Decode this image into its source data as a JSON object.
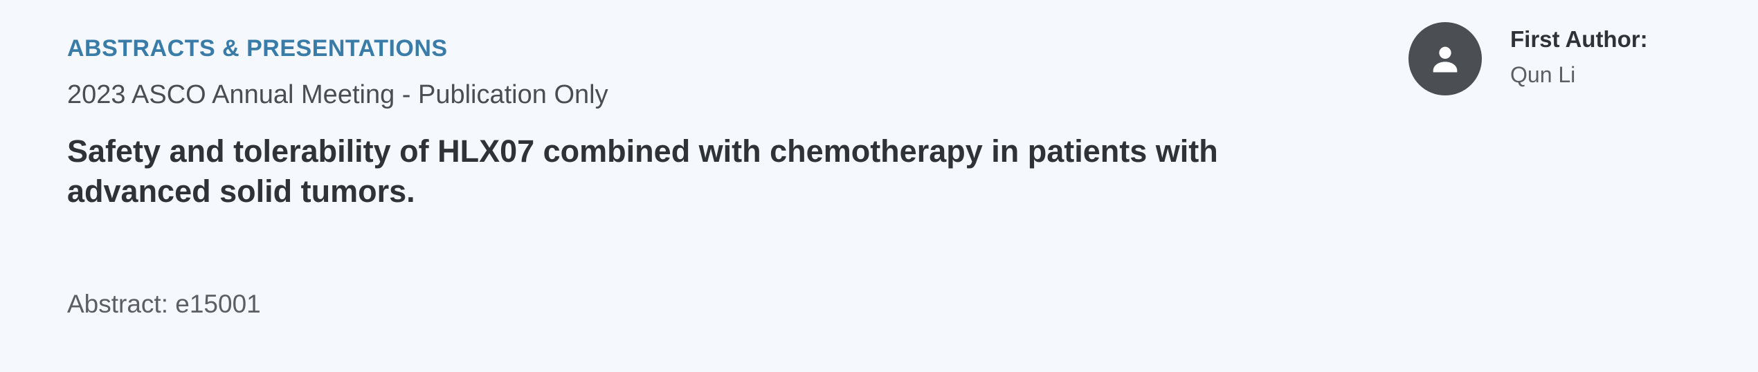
{
  "header": {
    "category": "ABSTRACTS & PRESENTATIONS",
    "meeting": "2023 ASCO Annual Meeting - Publication Only"
  },
  "article": {
    "title": "Safety and tolerability of HLX07 combined with chemotherapy in patients with advanced solid tumors.",
    "abstract_label": "Abstract: e15001"
  },
  "author": {
    "label": "First Author:",
    "name": "Qun Li",
    "avatar_icon": "person-icon"
  },
  "colors": {
    "background": "#f5f8fc",
    "category_link": "#3a7ca8",
    "avatar_bg": "#4b4e53",
    "title_text": "#2f3237"
  }
}
